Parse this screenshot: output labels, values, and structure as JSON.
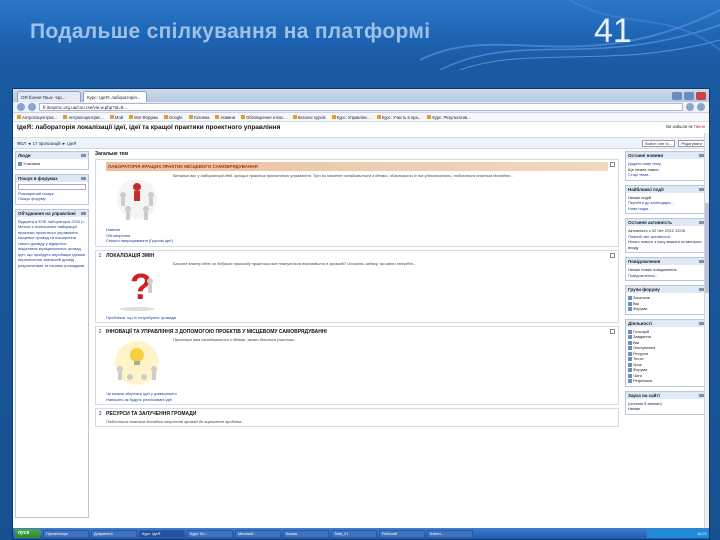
{
  "slide": {
    "title": "Подальше спілкування на платформі",
    "number": "41"
  },
  "browser": {
    "tabs": [
      "ОЯ Ёзння Гвьа: чэр...",
      "Курс: IдеЯ: лабораторія...",
      "",
      "",
      ""
    ],
    "url": "fr.itcsproc.org.ua/cou.rse/vie.w.php?id=8...",
    "bookmarks": [
      "Антропоцентрис...",
      "Антропоцентрис...",
      "Мой",
      "Мої Форумы",
      "Google",
      "Головна",
      "Новини",
      "Обговорення н-Кос...",
      "Каталог курсів",
      "Курс: Управлінє...",
      "Курс: Участь в пра...",
      "Курс: Результатив..."
    ]
  },
  "moodle": {
    "title": "IдеЯ: лабораторія локалізації ідеї, ідеї та кращої практики проектного управління",
    "login": "Ви зайшли як",
    "login_user": "Ганна",
    "breadcrumb": "ФЕЛ ◄ 17 пропозицій ► IдеЯ",
    "switch_role": "Switch role to...",
    "edit_button": "Редагувати"
  },
  "left": {
    "people": {
      "title": "Люди",
      "items": [
        "Учасники"
      ]
    },
    "search": {
      "title": "Пошук в форумах",
      "items": [
        "Розширений пошук",
        "Пошук форуму"
      ]
    },
    "admin": {
      "title": "Об'єднання на управлінні",
      "text": "Відкрита в ЕЛЕ лабораторія 2010 р. Метою є поліпшення найкращої практики проектного управління місцевих громад та поширення такого досвіду у відкритих ініціативах муніципальних громад. Ідеї, що пройдуть апробацію ідеями перенесення зовнішній досвід результатами та іншими громадами",
      "highlight": "Місцеве"
    }
  },
  "center": {
    "topic_title": "Загальне тем",
    "banner": "ЛАБОРАТОРІЯ КРАЩИХ ПРАКТИК МІСЦЕВОГО САМОВРЯДУВАННЯ",
    "sections": [
      {
        "num": "",
        "title": "",
        "text": "Вітаємо вас у лабораторії ідей, кращих практик проектного управління. Тут ви можете ознайомитися з ідеями, обговорити їх та удосконалити, поділитися власним досвідом...",
        "links": [
          "Новини",
          "Обговорення",
          "Спільні напрацювання (Групові ідеї)"
        ]
      },
      {
        "num": "1",
        "title": "ЛОКАЛІЗАЦІЯ ЗМІН",
        "text": "Бачите власну ідею чи доброго прикладу практики яке планується впровадити в громаді? Опишіть задачу, які зміни потрібні...",
        "links": [
          "Проблеми, що їх потребують громади"
        ]
      },
      {
        "num": "2",
        "title": "ІННОВАЦІЇ ТА УПРАВЛІННЯ З ДОПОМОГОЮ ПРОЕКТІВ У МІСЦЕВОМУ САМОВРЯДУВАННІ",
        "text": "Пропоную вам ознайомитися з ідеями, якими ділилися учасники...",
        "links": [
          "Чи можна зберігати ідеї у домашнього",
          "Напишіть як будуть реалізовані ідеї"
        ]
      },
      {
        "num": "3",
        "title": "РЕСУРСИ ТА ЗАЛУЧЕННЯ ГРОМАДИ",
        "text": "Поділитися власним досвідом залучення громад до вирішення проблем...",
        "links": []
      }
    ]
  },
  "right": {
    "news": {
      "title": "Останні новини",
      "items": [
        "Додати нову тему",
        "Ще немає новин",
        "Старі теми..."
      ]
    },
    "events": {
      "title": "Найближчі події",
      "items": [
        "Немає подій",
        "Перейти до календаря...",
        "Нова подія..."
      ]
    },
    "activity": {
      "title": "Остання активність",
      "items": [
        "Активність з 02 Чет 2012 13:05",
        "Повний звіт активності...",
        "Нічого нового з часу вашого останнього входу"
      ]
    },
    "messages": {
      "title": "Повідомлення",
      "items": [
        "Немає нових повідомлень",
        "Повідомлення..."
      ]
    },
    "groups": {
      "title": "Групи форуму",
      "items": [
        "Загальне",
        "Вікі",
        "Форуми"
      ]
    },
    "activities": {
      "title": "Діяльності",
      "items": [
        "Глосарій",
        "Завдання",
        "Вікі",
        "Опитування",
        "Ресурси",
        "Тести",
        "Урок",
        "Форуми",
        "Чати",
        "Рефлексія"
      ]
    },
    "online": {
      "title": "Зараз на сайті",
      "items": [
        "(останні 5 хвилин)",
        "Немає"
      ]
    }
  },
  "taskbar": {
    "start": "пуск",
    "tasks": [
      "Презентація",
      "Документ1",
      "Курс: IдеЯ",
      "Курс: Ко...",
      "Microsoft...",
      "Кошик",
      "Total_21",
      "Рабочий",
      "Клієнт..."
    ],
    "time": "16:21"
  }
}
